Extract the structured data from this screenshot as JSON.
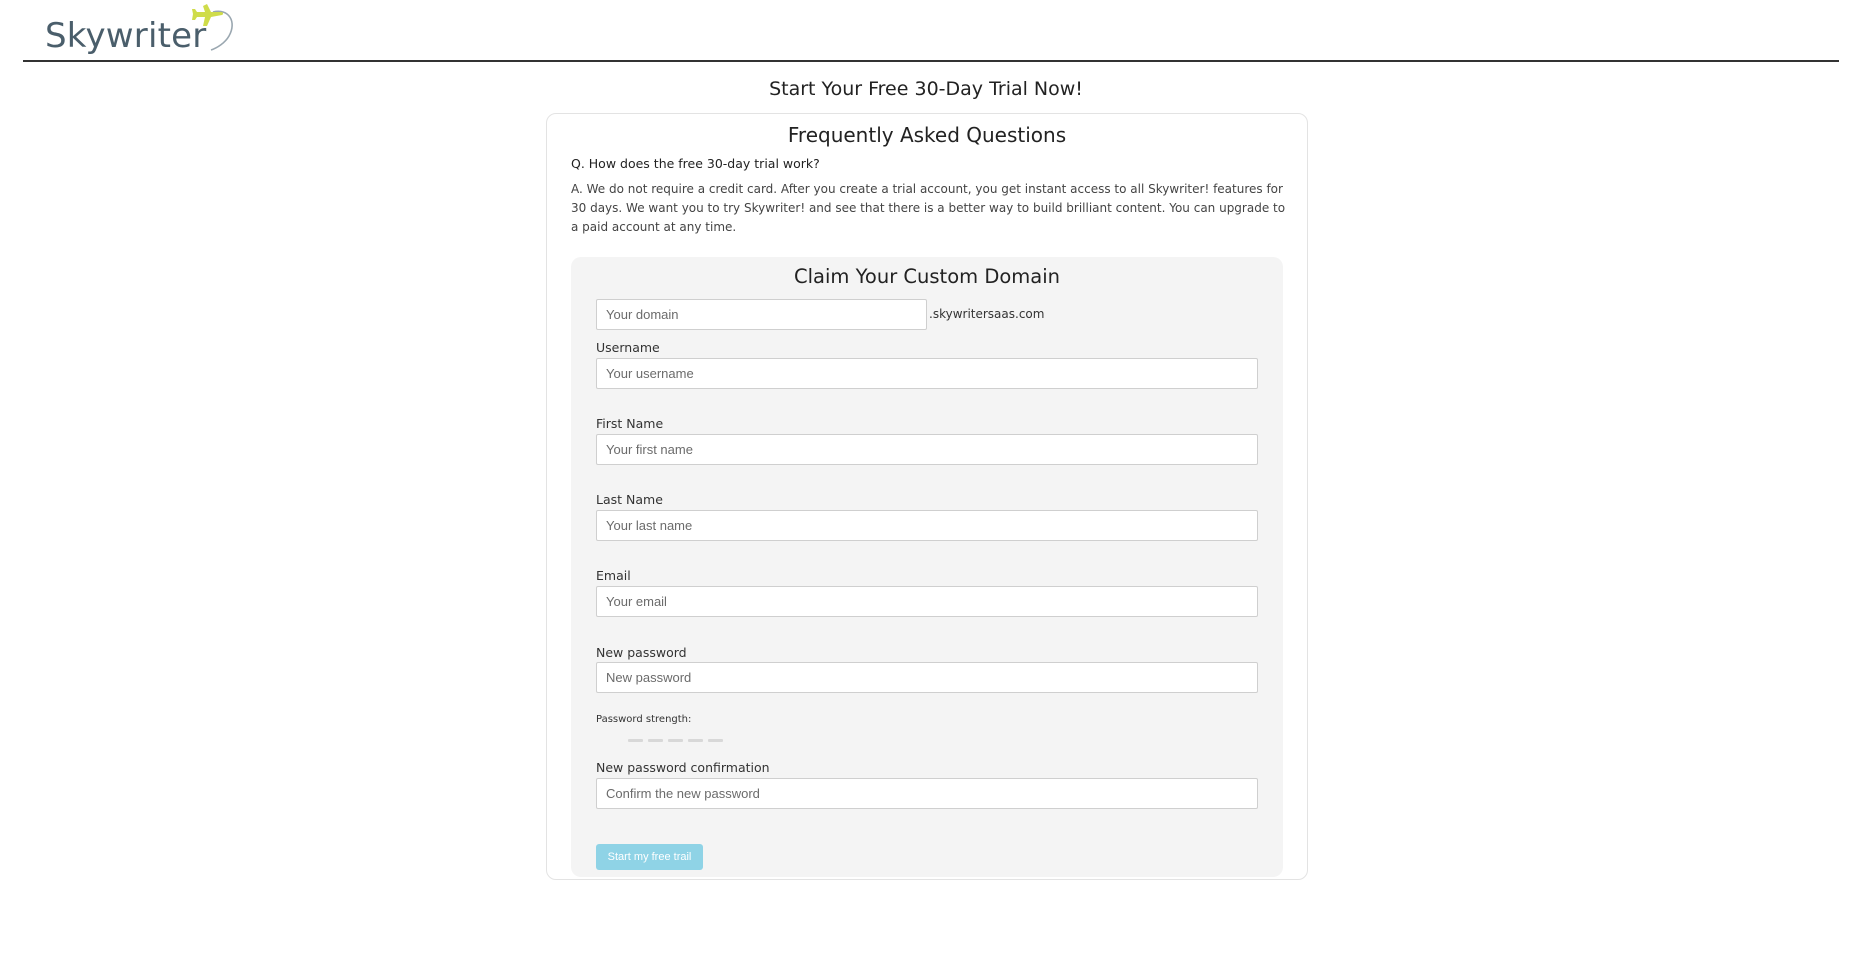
{
  "header": {
    "logo_text": "Skywriter"
  },
  "page": {
    "heading": "Start Your Free 30-Day Trial Now!"
  },
  "faq": {
    "title": "Frequently Asked Questions",
    "question": "Q. How does the free 30-day trial work?",
    "answer": "A. We do not require a credit card. After you create a trial account, you get instant access to all Skywriter! features for 30 days. We want you to try Skywriter! and see that there is a better way to build brilliant content. You can upgrade to a paid account at any time."
  },
  "form": {
    "title": "Claim Your Custom Domain",
    "domain": {
      "placeholder": "Your domain",
      "value": "",
      "suffix": ".skywritersaas.com"
    },
    "username": {
      "label": "Username",
      "placeholder": "Your username",
      "value": ""
    },
    "first_name": {
      "label": "First Name",
      "placeholder": "Your first name",
      "value": ""
    },
    "last_name": {
      "label": "Last Name",
      "placeholder": "Your last name",
      "value": ""
    },
    "email": {
      "label": "Email",
      "placeholder": "Your email",
      "value": ""
    },
    "password": {
      "label": "New password",
      "placeholder": "New password",
      "value": ""
    },
    "password_strength": {
      "label": "Password strength:",
      "level": 0,
      "max": 5
    },
    "password_confirm": {
      "label": "New password confirmation",
      "placeholder": "Confirm the new password",
      "value": ""
    },
    "submit_label": "Start my free trail"
  },
  "colors": {
    "logo_text": "#4a5e6b",
    "logo_plane": "#cfdc4a",
    "panel_bg": "#f4f4f4",
    "submit_bg": "#8fd3e6"
  }
}
